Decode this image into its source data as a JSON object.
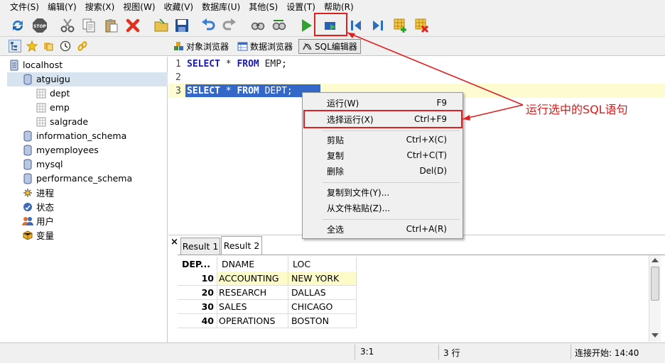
{
  "menu": [
    "文件(S)",
    "编辑(Y)",
    "搜索(X)",
    "视图(W)",
    "收藏(V)",
    "数据库(U)",
    "其他(S)",
    "设置(T)",
    "帮助(R)"
  ],
  "toolbar_icons": [
    "refresh-icon",
    "stop-icon",
    "cut-icon",
    "copy-icon",
    "paste-icon",
    "delete-icon",
    "open-folder-icon",
    "save-icon",
    "undo-icon",
    "redo-icon",
    "find-icon",
    "replace-icon",
    "run-icon",
    "run-selected-icon",
    "first-icon",
    "last-icon",
    "add-row-icon",
    "delete-row-icon"
  ],
  "views": {
    "object_browser": "对象浏览器",
    "data_browser": "数据浏览器",
    "sql_editor": "SQL编辑器"
  },
  "tree": {
    "server": "localhost",
    "databases": [
      "atguigu",
      "information_schema",
      "myemployees",
      "mysql",
      "performance_schema"
    ],
    "tables": [
      "dept",
      "emp",
      "salgrade"
    ],
    "others": [
      "进程",
      "状态",
      "用户",
      "变量"
    ]
  },
  "editor": {
    "lines": [
      {
        "num": "1",
        "kw1": "SELECT",
        "star": " * ",
        "kw2": "FROM",
        "rest": " EMP;"
      },
      {
        "num": "2"
      },
      {
        "num": "3",
        "kw1": "SELECT",
        "star": " * ",
        "kw2": "FROM",
        "rest": " DEPT;"
      }
    ]
  },
  "context_menu": [
    {
      "label": "运行(W)",
      "shortcut": "F9"
    },
    {
      "label": "选择运行(X)",
      "shortcut": "Ctrl+F9"
    },
    {
      "label": "剪贴",
      "shortcut": "Ctrl+X(C)"
    },
    {
      "label": "复制",
      "shortcut": "Ctrl+C(T)"
    },
    {
      "label": "删除",
      "shortcut": "Del(D)"
    },
    {
      "label": "复制到文件(Y)..."
    },
    {
      "label": "从文件粘贴(Z)..."
    },
    {
      "label": "全选",
      "shortcut": "Ctrl+A(R)"
    }
  ],
  "annotation": "运行选中的SQL语句",
  "results": {
    "close": "×",
    "tabs": [
      "Result 1",
      "Result 2"
    ],
    "columns": [
      "DEP...",
      "DNAME",
      "LOC"
    ],
    "rows": [
      [
        "10",
        "ACCOUNTING",
        "NEW YORK"
      ],
      [
        "20",
        "RESEARCH",
        "DALLAS"
      ],
      [
        "30",
        "SALES",
        "CHICAGO"
      ],
      [
        "40",
        "OPERATIONS",
        "BOSTON"
      ]
    ]
  },
  "status": {
    "position": "3:1",
    "rows": "3 行",
    "connect": "连接开始: 14:40"
  },
  "colors": {
    "highlight_border": "#e02020",
    "annotation": "#e01818",
    "selection": "#3468c8",
    "keyword": "#1a1ab0"
  }
}
